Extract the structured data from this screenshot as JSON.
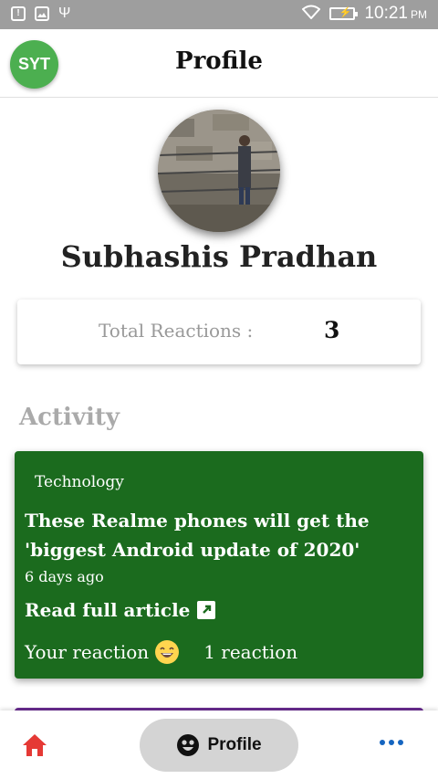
{
  "status_bar": {
    "time": "10:21",
    "ampm": "PM"
  },
  "header": {
    "avatar_initials": "SYT",
    "title": "Profile"
  },
  "profile": {
    "name": "Subhashis Pradhan"
  },
  "stats": {
    "reactions_label": "Total Reactions :",
    "reactions_value": "3"
  },
  "activity": {
    "section_title": "Activity",
    "items": [
      {
        "category": "Technology",
        "headline": "These Realme phones will get the 'biggest Android update of 2020'",
        "time_ago": "6 days ago",
        "read_more": "Read full article",
        "your_reaction_label": "Your reaction",
        "reaction_count": "1 reaction",
        "accent": "#1b6b1e"
      }
    ]
  },
  "bottom_nav": {
    "active_label": "Profile"
  },
  "colors": {
    "avatar": "#4caf50",
    "card": "#1b6b1e",
    "home_icon": "#e53935",
    "more_icon": "#1565c0",
    "next_card_accent": "#6a2c91"
  },
  "icons": [
    "notification-icon",
    "image-icon",
    "usb-icon",
    "wifi-icon",
    "battery-icon",
    "external-link-icon",
    "smiley-emoji-icon",
    "home-icon",
    "profile-face-icon",
    "more-dots-icon"
  ]
}
